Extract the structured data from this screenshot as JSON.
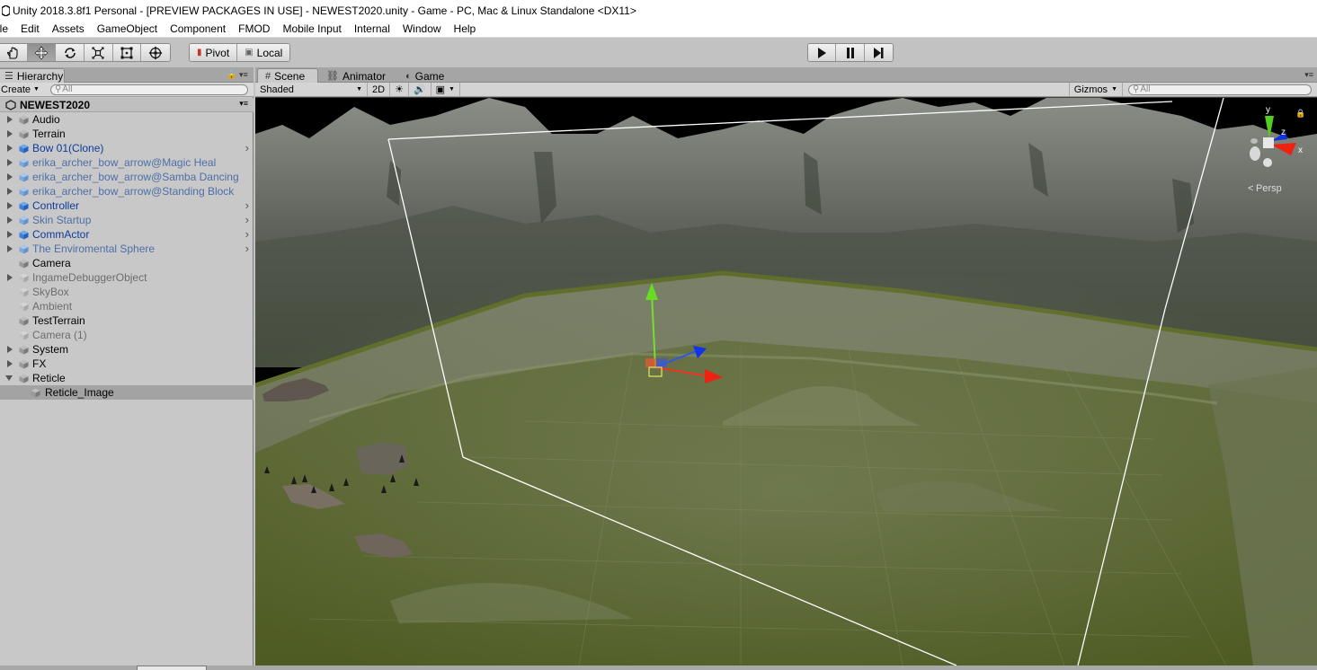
{
  "window": {
    "title": "Unity 2018.3.8f1 Personal - [PREVIEW PACKAGES IN USE] - NEWEST2020.unity - Game - PC, Mac & Linux Standalone <DX11>"
  },
  "menu": [
    "ile",
    "Edit",
    "Assets",
    "GameObject",
    "Component",
    "FMOD",
    "Mobile Input",
    "Internal",
    "Window",
    "Help"
  ],
  "toolbar": {
    "tools": [
      {
        "name": "hand-tool-button",
        "icon": "hand-icon",
        "active": false
      },
      {
        "name": "move-tool-button",
        "icon": "move-icon",
        "active": true
      },
      {
        "name": "rotate-tool-button",
        "icon": "rotate-icon",
        "active": false
      },
      {
        "name": "scale-tool-button",
        "icon": "scale-icon",
        "active": false
      },
      {
        "name": "rect-tool-button",
        "icon": "rect-icon",
        "active": false
      },
      {
        "name": "transform-tool-button",
        "icon": "transform-icon",
        "active": false
      }
    ],
    "pivot_label": "Pivot",
    "local_label": "Local"
  },
  "hierarchy": {
    "tab_label": "Hierarchy",
    "create_label": "Create",
    "search_placeholder": "All",
    "scene_name": "NEWEST2020",
    "items": [
      {
        "label": "Audio",
        "arrow": "closed",
        "style": "normal",
        "chevron": false,
        "cube": "gray"
      },
      {
        "label": "Terrain",
        "arrow": "closed",
        "style": "normal",
        "chevron": false,
        "cube": "gray"
      },
      {
        "label": "Bow 01(Clone)",
        "arrow": "closed",
        "style": "prefab",
        "chevron": true,
        "cube": "blue"
      },
      {
        "label": "erika_archer_bow_arrow@Magic Heal",
        "arrow": "closed",
        "style": "prefab-light",
        "chevron": false,
        "cube": "lightblue"
      },
      {
        "label": "erika_archer_bow_arrow@Samba Dancing",
        "arrow": "closed",
        "style": "prefab-light",
        "chevron": false,
        "cube": "lightblue"
      },
      {
        "label": "erika_archer_bow_arrow@Standing Block",
        "arrow": "closed",
        "style": "prefab-light",
        "chevron": false,
        "cube": "lightblue"
      },
      {
        "label": "Controller",
        "arrow": "closed",
        "style": "prefab",
        "chevron": true,
        "cube": "blue"
      },
      {
        "label": "Skin Startup",
        "arrow": "closed",
        "style": "prefab-light",
        "chevron": true,
        "cube": "lightblue"
      },
      {
        "label": "CommActor",
        "arrow": "closed",
        "style": "prefab",
        "chevron": true,
        "cube": "blue"
      },
      {
        "label": "The Enviromental Sphere",
        "arrow": "closed",
        "style": "prefab-light",
        "chevron": true,
        "cube": "lightblue"
      },
      {
        "label": "Camera",
        "arrow": "none",
        "style": "normal",
        "chevron": false,
        "cube": "gray"
      },
      {
        "label": "IngameDebuggerObject",
        "arrow": "closed",
        "style": "disabled",
        "chevron": false,
        "cube": "lightgray"
      },
      {
        "label": "SkyBox",
        "arrow": "none",
        "style": "disabled",
        "chevron": false,
        "cube": "lightgray"
      },
      {
        "label": "Ambient",
        "arrow": "none",
        "style": "disabled",
        "chevron": false,
        "cube": "lightgray"
      },
      {
        "label": "TestTerrain",
        "arrow": "none",
        "style": "normal",
        "chevron": false,
        "cube": "gray"
      },
      {
        "label": "Camera (1)",
        "arrow": "none",
        "style": "disabled",
        "chevron": false,
        "cube": "lightgray"
      },
      {
        "label": "System",
        "arrow": "closed",
        "style": "normal",
        "chevron": false,
        "cube": "gray"
      },
      {
        "label": "FX",
        "arrow": "closed",
        "style": "normal",
        "chevron": false,
        "cube": "gray"
      },
      {
        "label": "Reticle",
        "arrow": "open",
        "style": "normal",
        "chevron": false,
        "cube": "gray"
      },
      {
        "label": "Reticle_Image",
        "arrow": "none",
        "style": "normal",
        "chevron": false,
        "cube": "gray",
        "child": true,
        "selected": true
      }
    ]
  },
  "scene": {
    "tabs": [
      {
        "label": "Scene",
        "icon": "grid-icon",
        "active": true
      },
      {
        "label": "Animator",
        "icon": "animator-icon",
        "active": false
      },
      {
        "label": "Game",
        "icon": "game-icon",
        "active": false
      }
    ],
    "shading_mode": "Shaded",
    "mode_2d": "2D",
    "gizmos_label": "Gizmos",
    "search_placeholder": "All",
    "persp_label": "Persp",
    "axis_labels": {
      "y": "y",
      "z": "z",
      "x": "x"
    }
  },
  "colors": {
    "editor_bg": "#c2c2c2",
    "prefab_text": "#0d3b9b",
    "prefab_light_text": "#4e6ea8",
    "selection": "#a3a3a3",
    "terrain_green": "#5b6a2e",
    "cliff_gray": "#5f6459",
    "sky": "#000000"
  }
}
